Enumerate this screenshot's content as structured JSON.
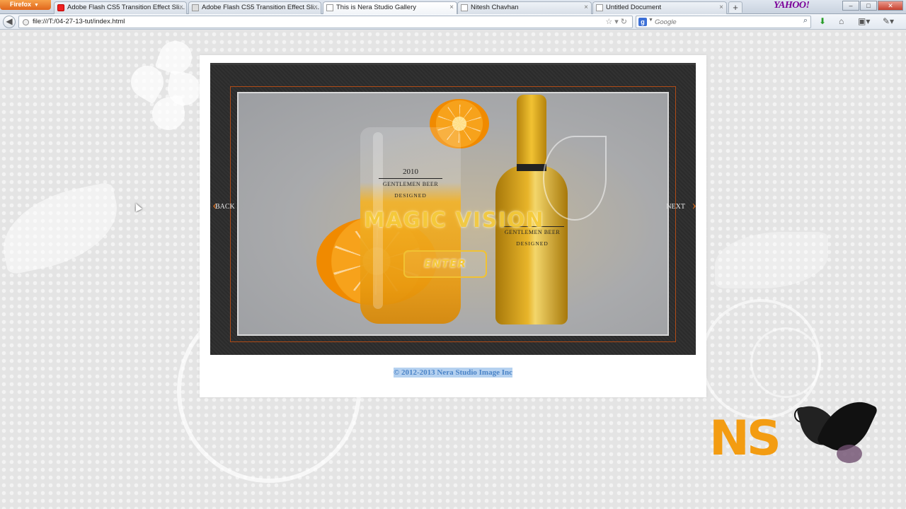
{
  "browser": {
    "menu_button": "Firefox",
    "tabs": [
      {
        "label": "Adobe Flash CS5 Transition Effect Sli...",
        "favicon": "youtube-icon",
        "active": false
      },
      {
        "label": "Adobe Flash CS5 Transition Effect Sli...",
        "favicon": "flash-icon",
        "active": false
      },
      {
        "label": "This is Nera Studio Gallery",
        "favicon": "page-icon",
        "active": true
      },
      {
        "label": "Nitesh Chavhan",
        "favicon": "page-icon",
        "active": false
      },
      {
        "label": "Untitled Document",
        "favicon": "page-icon",
        "active": false
      }
    ],
    "new_tab": "+",
    "yahoo_logo": "YAHOO!",
    "address": "file:///T:/04-27-13-tut/index.html",
    "search_placeholder": "Google",
    "search_engine_letter": "g"
  },
  "slider": {
    "title": "MAGIC VISION",
    "enter_label": "ENTER",
    "back_label": "BACK",
    "next_label": "NEXT",
    "glass_label": {
      "year": "2010",
      "brand": "GENTLEMEN BEER",
      "sub": "DESIGNED"
    },
    "bottle_label": {
      "brand": "GENTLEMEN BEER",
      "sub": "DESIGNED"
    }
  },
  "footer": {
    "copyright": "© 2012-2013 Nera Studio Image Inc"
  },
  "logo": {
    "text": "NS"
  },
  "colors": {
    "accent_orange": "#f39c12",
    "frame_border": "#b04b16",
    "title_yellow": "#f6cc3c",
    "selection": "#b5d1f0"
  }
}
